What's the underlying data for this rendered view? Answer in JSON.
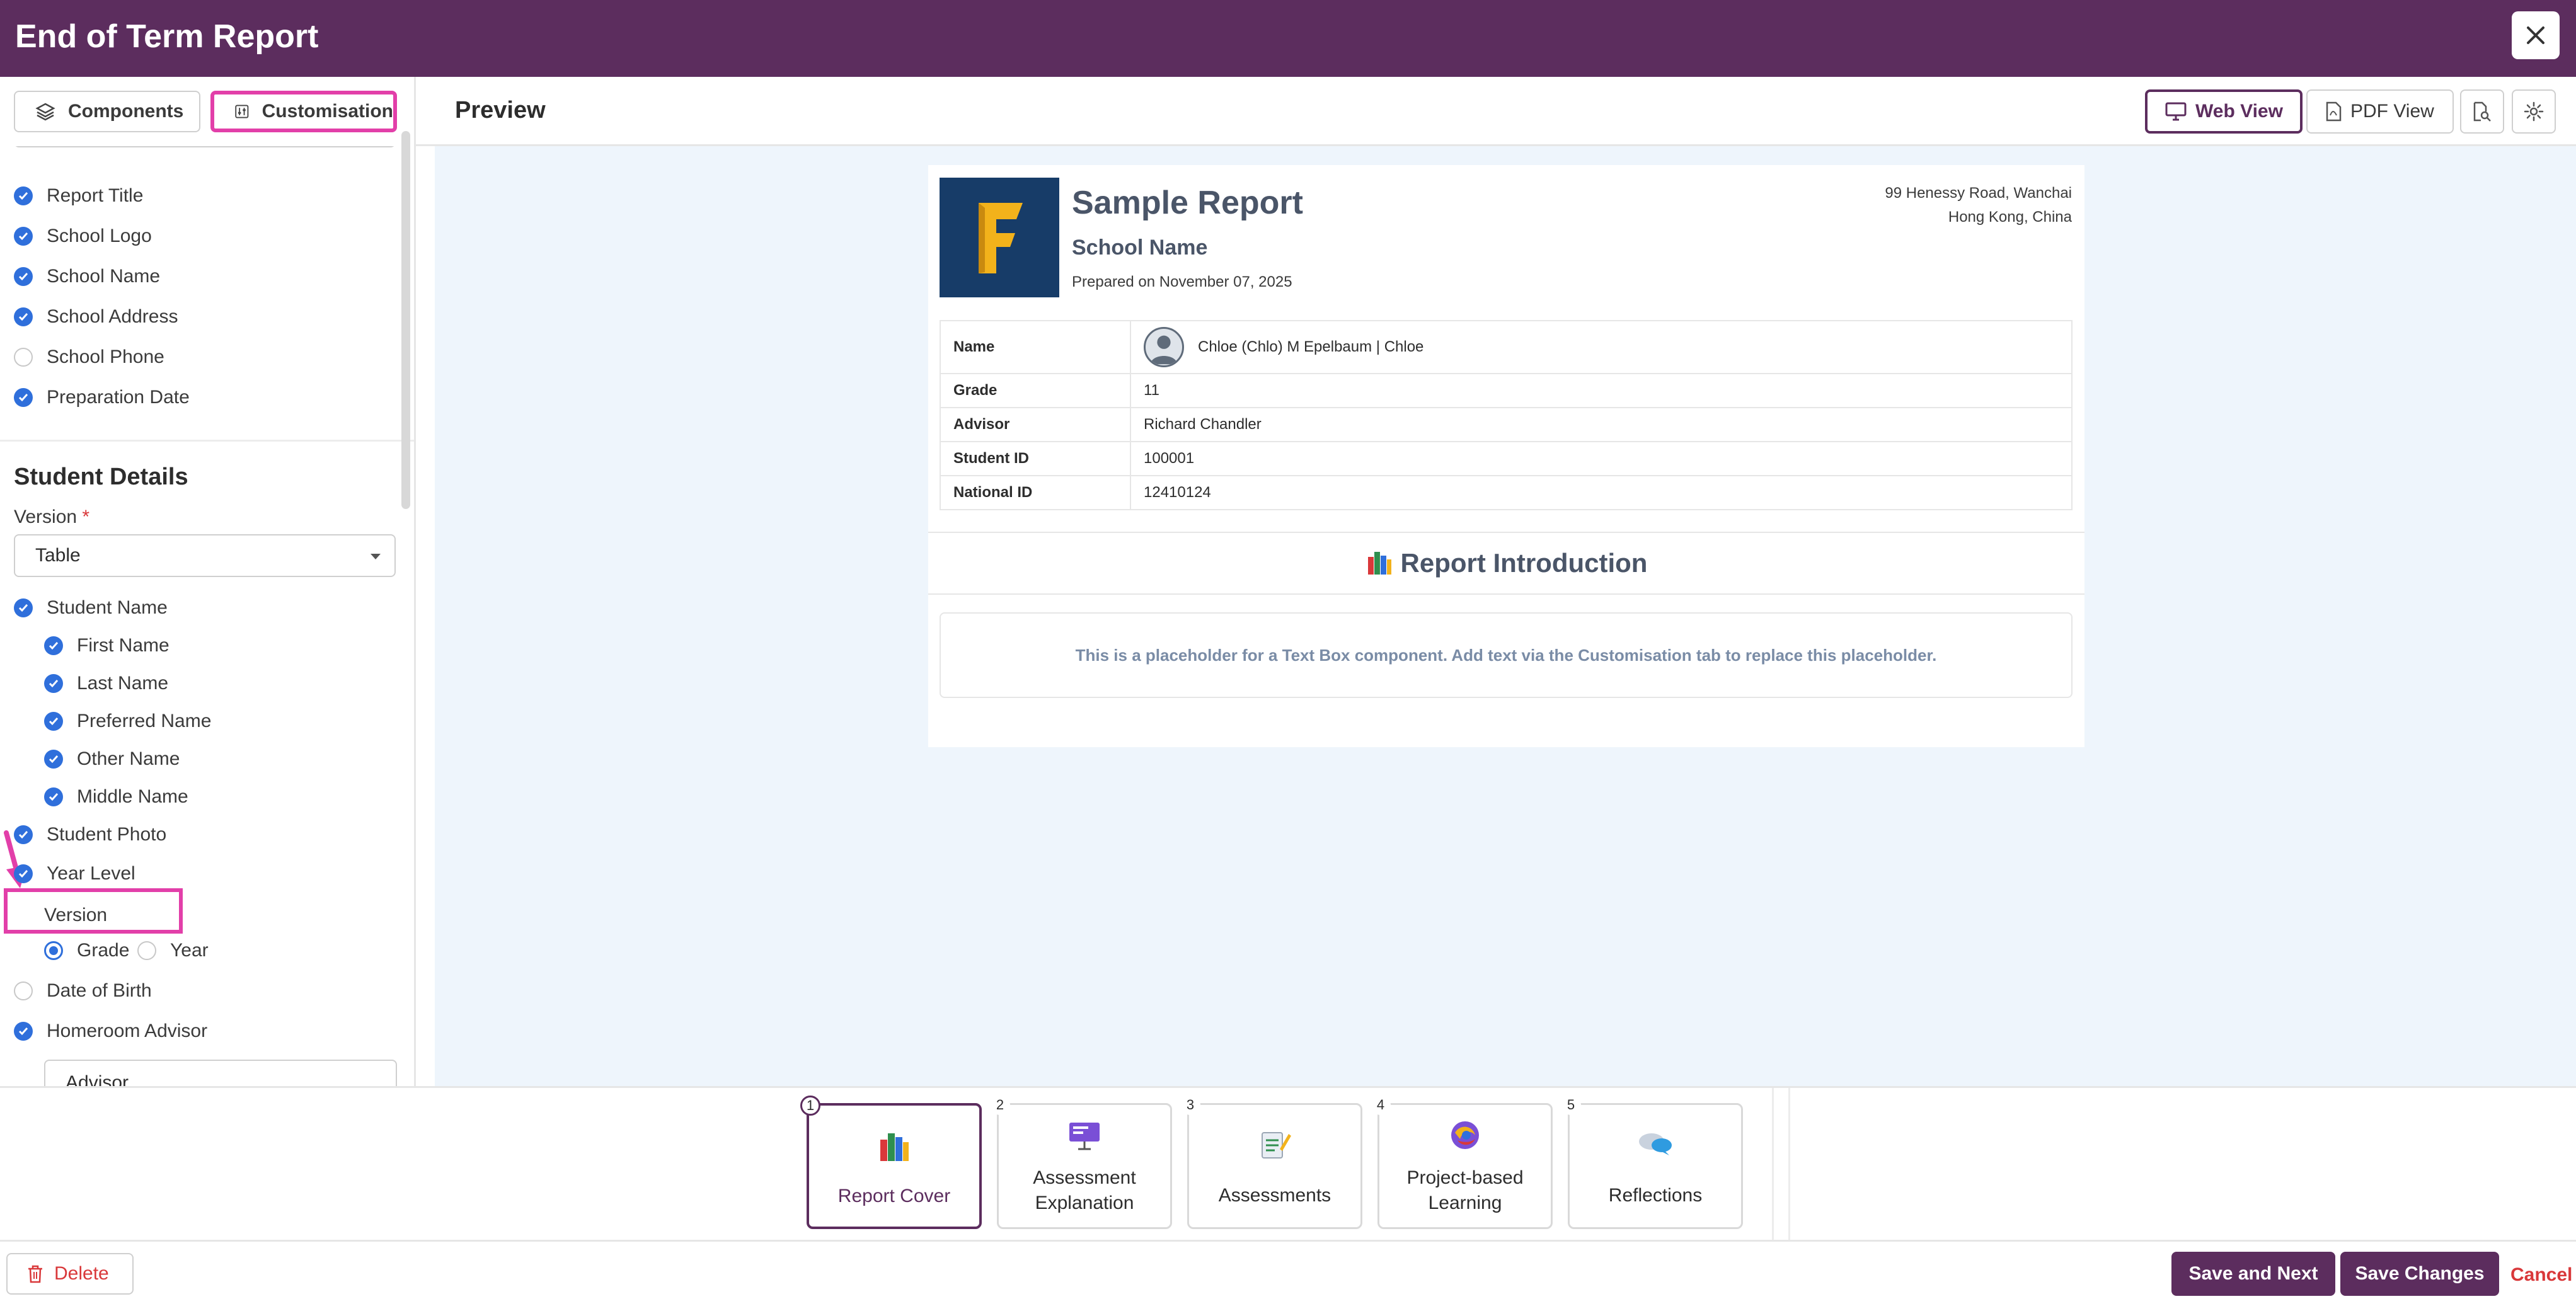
{
  "app": {
    "title": "End of Term Report"
  },
  "left_panel": {
    "tabs": {
      "components": "Components",
      "customisation": "Customisation"
    },
    "header_options": [
      {
        "label": "Report Title",
        "checked": true
      },
      {
        "label": "School Logo",
        "checked": true
      },
      {
        "label": "School Name",
        "checked": true
      },
      {
        "label": "School Address",
        "checked": true
      },
      {
        "label": "School Phone",
        "checked": false
      },
      {
        "label": "Preparation Date",
        "checked": true
      }
    ],
    "student_details": {
      "title": "Student Details",
      "version_label": "Version",
      "required_mark": "*",
      "version_value": "Table",
      "student_name": "Student Name",
      "name_parts": [
        "First Name",
        "Last Name",
        "Preferred Name",
        "Other Name",
        "Middle Name"
      ],
      "student_photo": "Student Photo",
      "year_level": "Year Level",
      "year_version_label": "Version",
      "radio_grade": "Grade",
      "radio_year": "Year",
      "date_of_birth": "Date of Birth",
      "homeroom_advisor": "Homeroom Advisor",
      "advisor_input_value": "Advisor"
    }
  },
  "preview": {
    "title": "Preview",
    "web_view": "Web View",
    "pdf_view": "PDF View",
    "report": {
      "logo_letter": "F",
      "title": "Sample Report",
      "school_name": "School Name",
      "prepared": "Prepared on November 07, 2025",
      "address_line1": "99 Henessy Road, Wanchai",
      "address_line2": "Hong Kong, China",
      "rows": [
        {
          "label": "Name",
          "value": "Chloe (Chlo) M Epelbaum | Chloe"
        },
        {
          "label": "Grade",
          "value": "11"
        },
        {
          "label": "Advisor",
          "value": "Richard Chandler"
        },
        {
          "label": "Student ID",
          "value": "100001"
        },
        {
          "label": "National ID",
          "value": "12410124"
        }
      ],
      "intro_title": "Report Introduction",
      "placeholder": "This is a placeholder for a Text Box component. Add text via the Customisation tab to replace this placeholder."
    }
  },
  "pages": [
    {
      "num": "1",
      "line1": "Report Cover",
      "line2": ""
    },
    {
      "num": "2",
      "line1": "Assessment",
      "line2": "Explanation"
    },
    {
      "num": "3",
      "line1": "Assessments",
      "line2": ""
    },
    {
      "num": "4",
      "line1": "Project-based",
      "line2": "Learning"
    },
    {
      "num": "5",
      "line1": "Reflections",
      "line2": ""
    }
  ],
  "footer": {
    "delete": "Delete",
    "save_next": "Save and Next",
    "save_changes": "Save Changes",
    "cancel": "Cancel"
  },
  "colors": {
    "brand": "#5c2d5e",
    "checkbox": "#2f6fdb",
    "highlight": "#e23fa9",
    "danger": "#d9383a",
    "preview_bg": "#eef5fc"
  }
}
